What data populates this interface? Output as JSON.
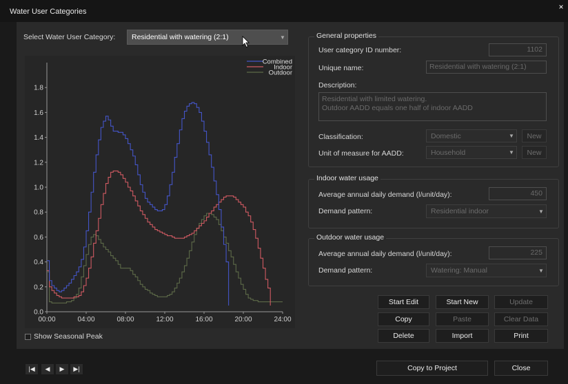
{
  "window": {
    "title": "Water User Categories",
    "close_glyph": "×"
  },
  "selector": {
    "label": "Select Water User Category:",
    "value": "Residential with watering (2:1)"
  },
  "chart_data": {
    "type": "line",
    "title": "",
    "xlabel": "",
    "ylabel": "",
    "x_ticks": [
      "00:00",
      "04:00",
      "08:00",
      "12:00",
      "16:00",
      "20:00",
      "24:00"
    ],
    "y_ticks": [
      "0.0",
      "0.2",
      "0.4",
      "0.6",
      "0.8",
      "1.0",
      "1.2",
      "1.4",
      "1.6",
      "1.8"
    ],
    "xlim": [
      0,
      24
    ],
    "ylim": [
      0,
      2.0
    ],
    "grid": false,
    "legend": "top-right",
    "step": true,
    "x": [
      0,
      0.25,
      0.5,
      0.75,
      1,
      1.25,
      1.5,
      1.75,
      2,
      2.25,
      2.5,
      2.75,
      3,
      3.25,
      3.5,
      3.75,
      4,
      4.25,
      4.5,
      4.75,
      5,
      5.25,
      5.5,
      5.75,
      6,
      6.25,
      6.5,
      6.75,
      7,
      7.25,
      7.5,
      7.75,
      8,
      8.25,
      8.5,
      8.75,
      9,
      9.25,
      9.5,
      9.75,
      10,
      10.25,
      10.5,
      10.75,
      11,
      11.25,
      11.5,
      11.75,
      12,
      12.25,
      12.5,
      12.75,
      13,
      13.25,
      13.5,
      13.75,
      14,
      14.25,
      14.5,
      14.75,
      15,
      15.25,
      15.5,
      15.75,
      16,
      16.25,
      16.5,
      16.75,
      17,
      17.25,
      17.5,
      17.75,
      18,
      18.25,
      18.5,
      18.75,
      19,
      19.25,
      19.5,
      19.75,
      20,
      20.25,
      20.5,
      20.75,
      21,
      21.25,
      21.5,
      21.75,
      22,
      22.25,
      22.5,
      22.75,
      23,
      23.25,
      23.5,
      23.75,
      24
    ],
    "series": [
      {
        "name": "Combined",
        "color": "#4455c8",
        "values": [
          0.41,
          0.25,
          0.21,
          0.19,
          0.17,
          0.16,
          0.17,
          0.19,
          0.21,
          0.23,
          0.26,
          0.29,
          0.32,
          0.36,
          0.42,
          0.52,
          0.65,
          0.8,
          0.96,
          1.12,
          1.26,
          1.38,
          1.48,
          1.53,
          1.57,
          1.54,
          1.49,
          1.45,
          1.45,
          1.44,
          1.44,
          1.42,
          1.39,
          1.35,
          1.3,
          1.25,
          1.18,
          1.1,
          1.02,
          0.96,
          0.91,
          0.88,
          0.86,
          0.84,
          0.82,
          0.81,
          0.81,
          0.82,
          0.86,
          0.93,
          1.02,
          1.12,
          1.24,
          1.35,
          1.46,
          1.55,
          1.61,
          1.65,
          1.67,
          1.68,
          1.67,
          1.64,
          1.6,
          1.53,
          1.45,
          1.36,
          1.26,
          1.16,
          1.05,
          0.94,
          0.82,
          0.68,
          0.54,
          0.4,
          0.05
        ]
      },
      {
        "name": "Indoor",
        "color": "#d05a62",
        "values": [
          0.33,
          0.2,
          0.17,
          0.15,
          0.13,
          0.12,
          0.11,
          0.11,
          0.11,
          0.11,
          0.11,
          0.12,
          0.12,
          0.13,
          0.16,
          0.21,
          0.27,
          0.35,
          0.44,
          0.55,
          0.65,
          0.75,
          0.86,
          0.95,
          1.03,
          1.08,
          1.12,
          1.13,
          1.13,
          1.12,
          1.1,
          1.07,
          1.04,
          1.0,
          0.97,
          0.93,
          0.89,
          0.85,
          0.81,
          0.78,
          0.75,
          0.72,
          0.7,
          0.68,
          0.66,
          0.65,
          0.64,
          0.63,
          0.62,
          0.61,
          0.61,
          0.6,
          0.59,
          0.59,
          0.59,
          0.59,
          0.6,
          0.61,
          0.62,
          0.63,
          0.65,
          0.67,
          0.69,
          0.71,
          0.73,
          0.76,
          0.79,
          0.81,
          0.84,
          0.86,
          0.88,
          0.9,
          0.92,
          0.93,
          0.93,
          0.93,
          0.92,
          0.9,
          0.88,
          0.86,
          0.84,
          0.8,
          0.77,
          0.72,
          0.66,
          0.59,
          0.51,
          0.43,
          0.35,
          0.26,
          0.19,
          0.05
        ]
      },
      {
        "name": "Outdoor",
        "color": "#5d6a48",
        "values": [
          0.32,
          0.08,
          0.07,
          0.07,
          0.07,
          0.07,
          0.07,
          0.07,
          0.08,
          0.08,
          0.09,
          0.11,
          0.14,
          0.19,
          0.28,
          0.37,
          0.46,
          0.54,
          0.6,
          0.62,
          0.61,
          0.58,
          0.55,
          0.52,
          0.5,
          0.48,
          0.45,
          0.43,
          0.41,
          0.38,
          0.35,
          0.35,
          0.35,
          0.35,
          0.33,
          0.3,
          0.28,
          0.25,
          0.22,
          0.2,
          0.18,
          0.17,
          0.15,
          0.14,
          0.13,
          0.12,
          0.12,
          0.12,
          0.12,
          0.13,
          0.14,
          0.16,
          0.19,
          0.23,
          0.27,
          0.32,
          0.37,
          0.43,
          0.49,
          0.56,
          0.62,
          0.67,
          0.71,
          0.74,
          0.77,
          0.79,
          0.79,
          0.78,
          0.76,
          0.74,
          0.7,
          0.65,
          0.6,
          0.55,
          0.49,
          0.44,
          0.38,
          0.32,
          0.27,
          0.22,
          0.18,
          0.14,
          0.11,
          0.1,
          0.09,
          0.09,
          0.08,
          0.08,
          0.08,
          0.08,
          0.08,
          0.08,
          0.08,
          0.08,
          0.08,
          0.08,
          0.08,
          0.08,
          0.08
        ]
      }
    ]
  },
  "seasonal_peak": {
    "label": "Show Seasonal Peak",
    "checked": false
  },
  "general": {
    "title": "General properties",
    "id_label": "User category ID number:",
    "id_value": "1102",
    "name_label": "Unique name:",
    "name_value": "Residential with watering (2:1)",
    "desc_label": "Description:",
    "desc_value": "Residential with limited watering.\nOutdoor AADD equals one half of indoor AADD",
    "class_label": "Classification:",
    "class_value": "Domestic",
    "unit_label": "Unit of measure for AADD:",
    "unit_value": "Household",
    "new_label": "New"
  },
  "indoor": {
    "title": "Indoor water usage",
    "aadd_label": "Average annual daily demand (l/unit/day):",
    "aadd_value": "450",
    "pattern_label": "Demand pattern:",
    "pattern_value": "Residential indoor"
  },
  "outdoor": {
    "title": "Outdoor water usage",
    "aadd_label": "Average annual daily demand (l/unit/day):",
    "aadd_value": "225",
    "pattern_label": "Demand pattern:",
    "pattern_value": "Watering: Manual"
  },
  "buttons": {
    "start_edit": "Start Edit",
    "start_new": "Start New",
    "update": "Update",
    "copy": "Copy",
    "paste": "Paste",
    "clear_data": "Clear Data",
    "delete": "Delete",
    "import": "Import",
    "print": "Print",
    "copy_to_project": "Copy to Project",
    "close": "Close"
  },
  "navigation": {
    "first": "|◀",
    "prev": "◀",
    "next": "▶",
    "last": "▶|"
  }
}
